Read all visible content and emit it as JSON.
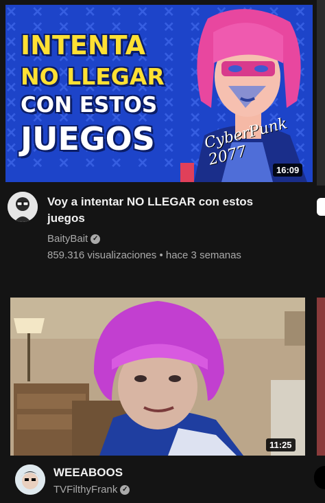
{
  "videos": [
    {
      "thumbnail_text": [
        "INTENTA",
        "NO LLEGAR",
        "CON ESTOS",
        "JUEGOS"
      ],
      "thumbnail_logo": "CyberPunk 2077",
      "duration": "16:09",
      "title_line1": "Voy a intentar NO LLEGAR con estos",
      "title_line2": "juegos",
      "channel": "BaityBait",
      "stats": "859.316 visualizaciones • hace 3 semanas"
    },
    {
      "duration": "11:25",
      "title": "WEEABOOS",
      "channel": "TVFilthyFrank"
    }
  ],
  "colors": {
    "background": "#141414",
    "thumbnail1_bg": "#1d44c9",
    "hair_pink": "#d94cc0",
    "text_primary": "#f1f1f1",
    "text_secondary": "#aaaaaa"
  },
  "icons": [
    "verified-check-icon",
    "avatar"
  ]
}
